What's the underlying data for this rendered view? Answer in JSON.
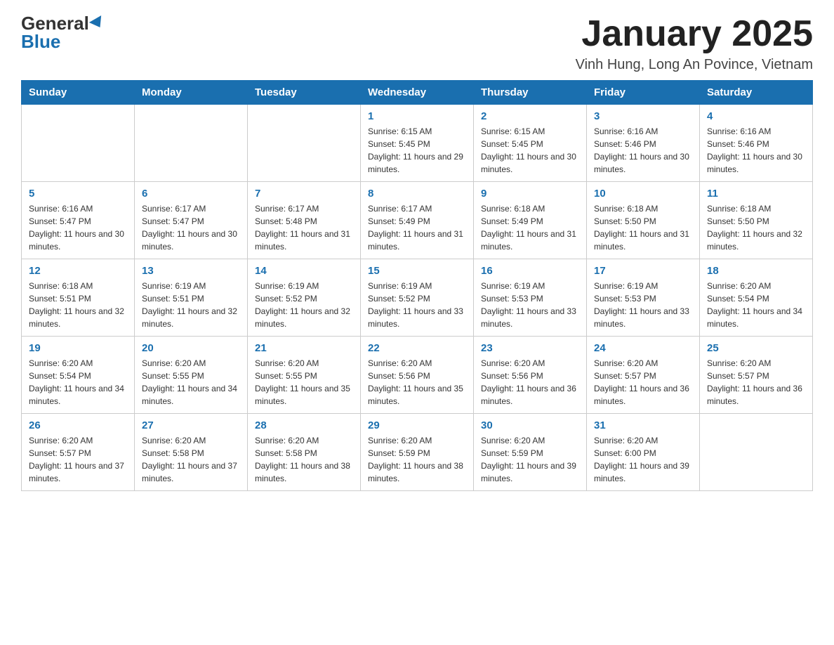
{
  "logo": {
    "general": "General",
    "blue": "Blue"
  },
  "title": "January 2025",
  "subtitle": "Vinh Hung, Long An Povince, Vietnam",
  "days_of_week": [
    "Sunday",
    "Monday",
    "Tuesday",
    "Wednesday",
    "Thursday",
    "Friday",
    "Saturday"
  ],
  "weeks": [
    [
      {
        "day": "",
        "info": ""
      },
      {
        "day": "",
        "info": ""
      },
      {
        "day": "",
        "info": ""
      },
      {
        "day": "1",
        "info": "Sunrise: 6:15 AM\nSunset: 5:45 PM\nDaylight: 11 hours and 29 minutes."
      },
      {
        "day": "2",
        "info": "Sunrise: 6:15 AM\nSunset: 5:45 PM\nDaylight: 11 hours and 30 minutes."
      },
      {
        "day": "3",
        "info": "Sunrise: 6:16 AM\nSunset: 5:46 PM\nDaylight: 11 hours and 30 minutes."
      },
      {
        "day": "4",
        "info": "Sunrise: 6:16 AM\nSunset: 5:46 PM\nDaylight: 11 hours and 30 minutes."
      }
    ],
    [
      {
        "day": "5",
        "info": "Sunrise: 6:16 AM\nSunset: 5:47 PM\nDaylight: 11 hours and 30 minutes."
      },
      {
        "day": "6",
        "info": "Sunrise: 6:17 AM\nSunset: 5:47 PM\nDaylight: 11 hours and 30 minutes."
      },
      {
        "day": "7",
        "info": "Sunrise: 6:17 AM\nSunset: 5:48 PM\nDaylight: 11 hours and 31 minutes."
      },
      {
        "day": "8",
        "info": "Sunrise: 6:17 AM\nSunset: 5:49 PM\nDaylight: 11 hours and 31 minutes."
      },
      {
        "day": "9",
        "info": "Sunrise: 6:18 AM\nSunset: 5:49 PM\nDaylight: 11 hours and 31 minutes."
      },
      {
        "day": "10",
        "info": "Sunrise: 6:18 AM\nSunset: 5:50 PM\nDaylight: 11 hours and 31 minutes."
      },
      {
        "day": "11",
        "info": "Sunrise: 6:18 AM\nSunset: 5:50 PM\nDaylight: 11 hours and 32 minutes."
      }
    ],
    [
      {
        "day": "12",
        "info": "Sunrise: 6:18 AM\nSunset: 5:51 PM\nDaylight: 11 hours and 32 minutes."
      },
      {
        "day": "13",
        "info": "Sunrise: 6:19 AM\nSunset: 5:51 PM\nDaylight: 11 hours and 32 minutes."
      },
      {
        "day": "14",
        "info": "Sunrise: 6:19 AM\nSunset: 5:52 PM\nDaylight: 11 hours and 32 minutes."
      },
      {
        "day": "15",
        "info": "Sunrise: 6:19 AM\nSunset: 5:52 PM\nDaylight: 11 hours and 33 minutes."
      },
      {
        "day": "16",
        "info": "Sunrise: 6:19 AM\nSunset: 5:53 PM\nDaylight: 11 hours and 33 minutes."
      },
      {
        "day": "17",
        "info": "Sunrise: 6:19 AM\nSunset: 5:53 PM\nDaylight: 11 hours and 33 minutes."
      },
      {
        "day": "18",
        "info": "Sunrise: 6:20 AM\nSunset: 5:54 PM\nDaylight: 11 hours and 34 minutes."
      }
    ],
    [
      {
        "day": "19",
        "info": "Sunrise: 6:20 AM\nSunset: 5:54 PM\nDaylight: 11 hours and 34 minutes."
      },
      {
        "day": "20",
        "info": "Sunrise: 6:20 AM\nSunset: 5:55 PM\nDaylight: 11 hours and 34 minutes."
      },
      {
        "day": "21",
        "info": "Sunrise: 6:20 AM\nSunset: 5:55 PM\nDaylight: 11 hours and 35 minutes."
      },
      {
        "day": "22",
        "info": "Sunrise: 6:20 AM\nSunset: 5:56 PM\nDaylight: 11 hours and 35 minutes."
      },
      {
        "day": "23",
        "info": "Sunrise: 6:20 AM\nSunset: 5:56 PM\nDaylight: 11 hours and 36 minutes."
      },
      {
        "day": "24",
        "info": "Sunrise: 6:20 AM\nSunset: 5:57 PM\nDaylight: 11 hours and 36 minutes."
      },
      {
        "day": "25",
        "info": "Sunrise: 6:20 AM\nSunset: 5:57 PM\nDaylight: 11 hours and 36 minutes."
      }
    ],
    [
      {
        "day": "26",
        "info": "Sunrise: 6:20 AM\nSunset: 5:57 PM\nDaylight: 11 hours and 37 minutes."
      },
      {
        "day": "27",
        "info": "Sunrise: 6:20 AM\nSunset: 5:58 PM\nDaylight: 11 hours and 37 minutes."
      },
      {
        "day": "28",
        "info": "Sunrise: 6:20 AM\nSunset: 5:58 PM\nDaylight: 11 hours and 38 minutes."
      },
      {
        "day": "29",
        "info": "Sunrise: 6:20 AM\nSunset: 5:59 PM\nDaylight: 11 hours and 38 minutes."
      },
      {
        "day": "30",
        "info": "Sunrise: 6:20 AM\nSunset: 5:59 PM\nDaylight: 11 hours and 39 minutes."
      },
      {
        "day": "31",
        "info": "Sunrise: 6:20 AM\nSunset: 6:00 PM\nDaylight: 11 hours and 39 minutes."
      },
      {
        "day": "",
        "info": ""
      }
    ]
  ]
}
